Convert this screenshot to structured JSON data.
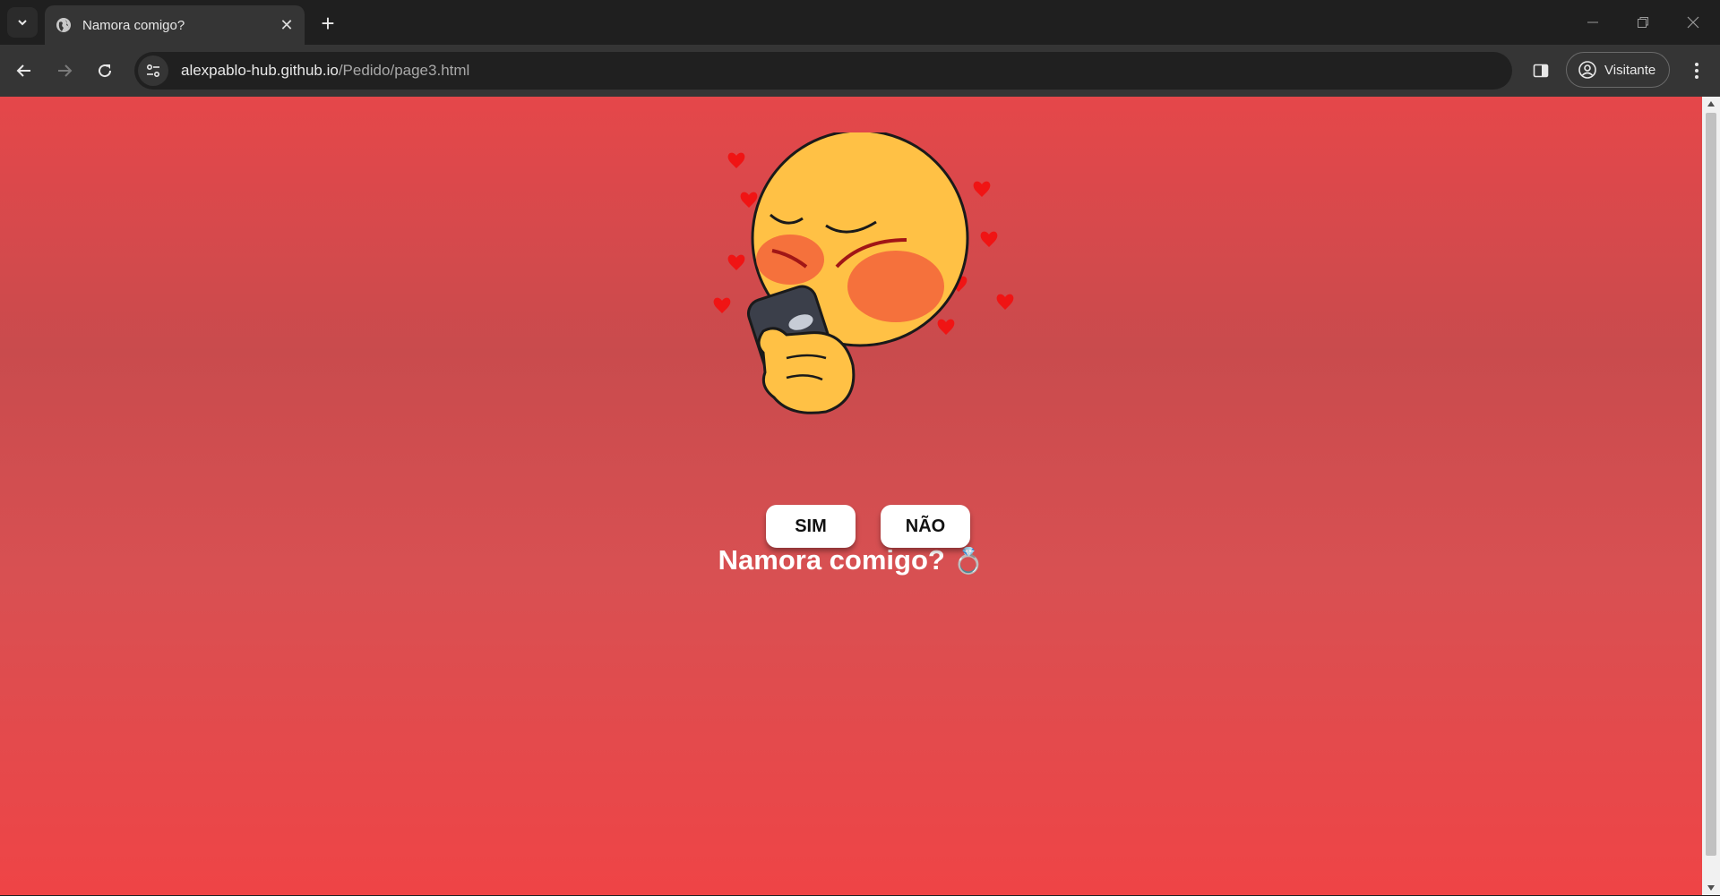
{
  "browser": {
    "tab_title": "Namora comigo?",
    "url_host": "alexpablo-hub.github.io",
    "url_path": "/Pedido/page3.html",
    "profile_label": "Visitante"
  },
  "page": {
    "question": "Namora comigo?",
    "question_emoji": "💍",
    "yes_label": "SIM",
    "no_label": "NÃO",
    "background_top": "#e5474a",
    "background_bottom": "#ef4446"
  },
  "icons": {
    "illustration": "blushing-emoji-holding-phone-with-hearts"
  }
}
